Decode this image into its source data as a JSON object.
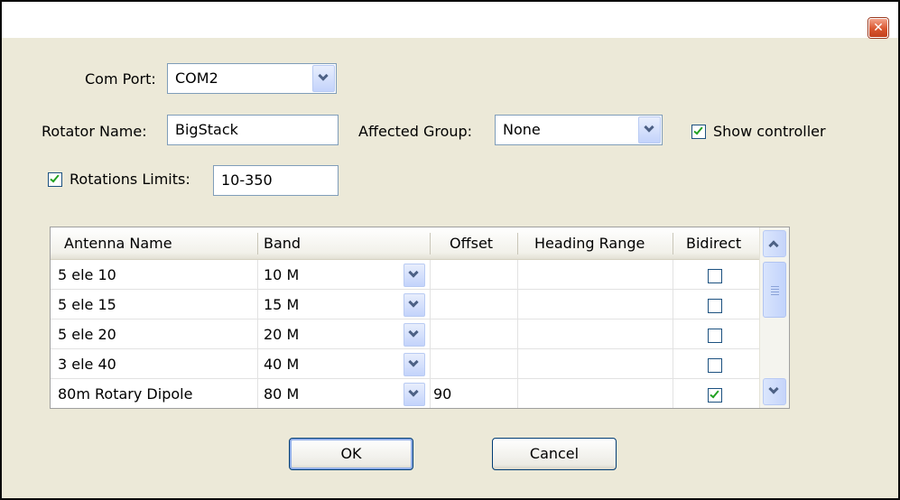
{
  "window": {
    "close_icon": "close-icon"
  },
  "com_port": {
    "label": "Com Port:",
    "value": "COM2"
  },
  "rotator_name": {
    "label": "Rotator Name:",
    "value": "BigStack"
  },
  "affected_group": {
    "label": "Affected Group:",
    "value": "None"
  },
  "show_controller": {
    "label": "Show controller",
    "checked": true
  },
  "rotation_limits": {
    "label": "Rotations Limits:",
    "checked": true,
    "value": "10-350"
  },
  "grid": {
    "columns": [
      "Antenna Name",
      "Band",
      "Offset",
      "Heading Range",
      "Bidirect"
    ],
    "rows": [
      {
        "name": "5 ele 10",
        "band": "10 M",
        "offset": "",
        "heading_range": "",
        "bidirect": false
      },
      {
        "name": "5 ele 15",
        "band": "15 M",
        "offset": "",
        "heading_range": "",
        "bidirect": false
      },
      {
        "name": "5 ele 20",
        "band": "20 M",
        "offset": "",
        "heading_range": "",
        "bidirect": false
      },
      {
        "name": "3 ele 40",
        "band": "40 M",
        "offset": "",
        "heading_range": "",
        "bidirect": false
      },
      {
        "name": "80m Rotary Dipole",
        "band": "80 M",
        "offset": "90",
        "heading_range": "",
        "bidirect": true
      }
    ]
  },
  "buttons": {
    "ok": "OK",
    "cancel": "Cancel"
  }
}
